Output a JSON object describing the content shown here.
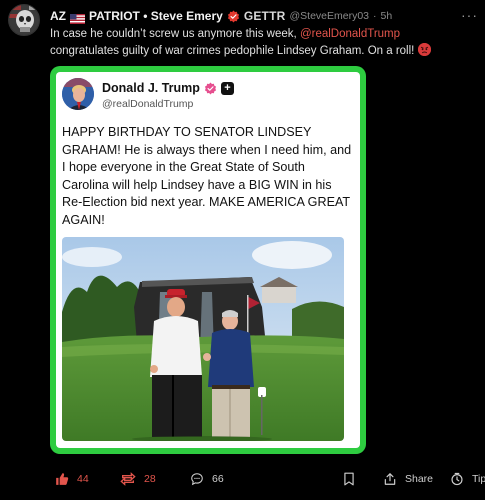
{
  "author": {
    "display_name": "AZ",
    "patriot_label": "PATRIOT • Steve Emery",
    "platform": "GETTR",
    "handle": "@SteveEmery03",
    "separator": "·",
    "age": "5h"
  },
  "post": {
    "text_before": "In case he couldn’t screw us anymore this week, ",
    "mention": "@realDonaldTrump",
    "text_after": " congratulates guilty of war crimes pedophile Lindsey Graham. On a roll! "
  },
  "embedded": {
    "name": "Donald J. Trump",
    "plus_icon": "+",
    "handle": "@realDonaldTrump",
    "text": "HAPPY BIRTHDAY TO SENATOR LINDSEY GRAHAM! He is always there when I need him, and I hope everyone in the Great State of South Carolina will help Lindsey have a BIG WIN in his Re-Election bid next year. MAKE AMERICA GREAT AGAIN!"
  },
  "actions": {
    "like_count": "44",
    "repost_count": "28",
    "comment_count": "66",
    "share_label": "Share",
    "tip_label": "Tip"
  },
  "more_label": "···",
  "colors": {
    "accent": "#e2554c",
    "frame_green": "#2ecc40",
    "background": "#000000"
  },
  "icons": [
    "skull-avatar-icon",
    "us-flag-icon",
    "red-verified-icon",
    "more-icon",
    "angry-emoji-icon",
    "pink-verified-icon",
    "like-icon",
    "repost-icon",
    "comment-icon",
    "bookmark-icon",
    "share-icon",
    "tip-icon"
  ]
}
